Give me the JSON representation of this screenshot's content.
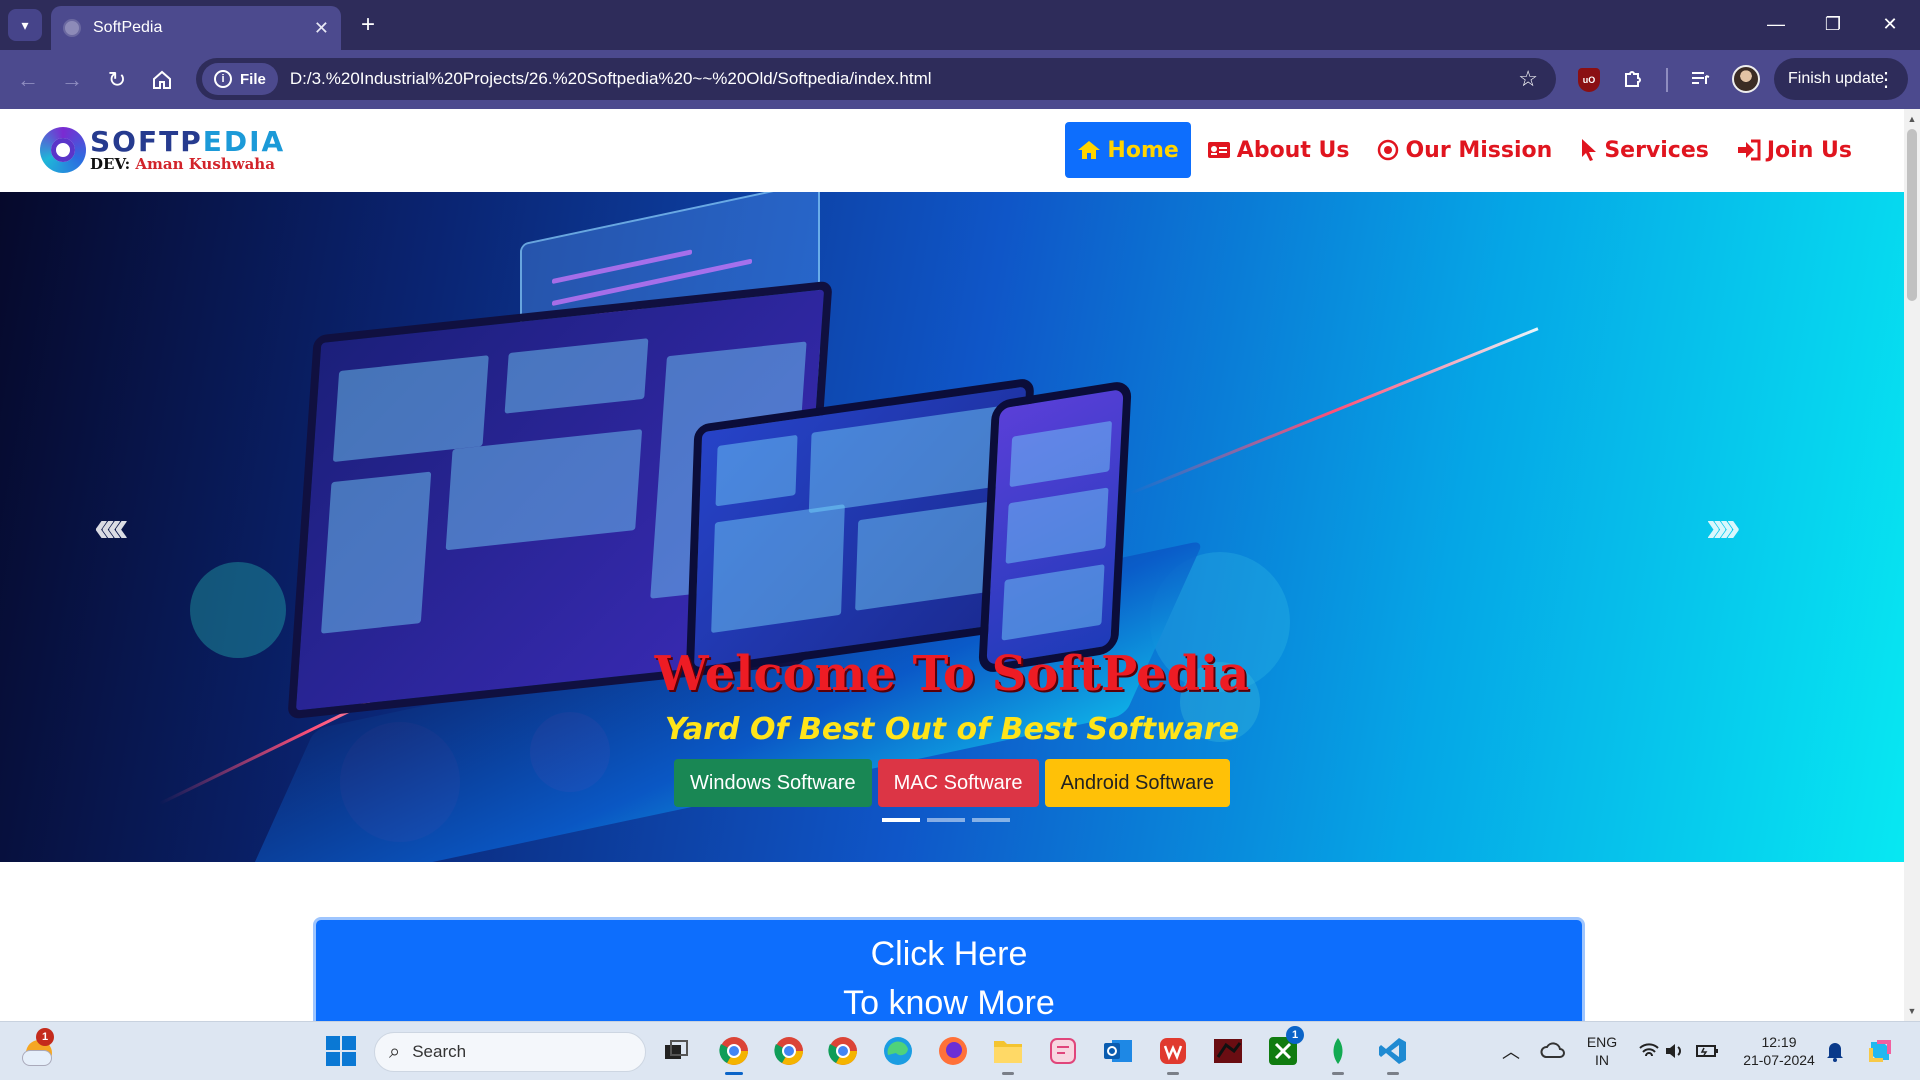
{
  "browser": {
    "tab_title": "SoftPedia",
    "url_chip": "File",
    "url": "D:/3.%20Industrial%20Projects/26.%20Softpedia%20~~%20Old/Softpedia/index.html",
    "finish_update": "Finish update",
    "ublock_label": "uO"
  },
  "site": {
    "logo_name_a": "SOFTP",
    "logo_name_b": "EDIA",
    "logo_dev_a": "DEV: ",
    "logo_dev_b": "Aman Kushwaha",
    "menu": [
      {
        "label": "Home",
        "icon": "home-icon"
      },
      {
        "label": "About Us",
        "icon": "id-card-icon"
      },
      {
        "label": "Our Mission",
        "icon": "target-icon"
      },
      {
        "label": "Services",
        "icon": "pointer-icon"
      },
      {
        "label": "Join Us",
        "icon": "sign-in-icon"
      }
    ],
    "hero": {
      "prev": "‹‹‹‹",
      "next": "››››",
      "title": "Welcome To SoftPedia",
      "subtitle": "Yard Of Best Out of Best Software",
      "buttons": [
        "Windows Software",
        "MAC Software",
        "Android Software"
      ],
      "active_slide": 1,
      "slide_count": 3
    },
    "more": {
      "line1": "Click Here",
      "line2": "To know More"
    }
  },
  "taskbar": {
    "search_placeholder": "Search",
    "weather_badge": "1",
    "xbox_badge": "1",
    "lang_line1": "ENG",
    "lang_line2": "IN",
    "time": "12:19",
    "date": "21-07-2024"
  },
  "colors": {
    "nav_accent": "#e0151f",
    "home_bg": "#0d6efd",
    "home_text": "#ffd400",
    "hero_title": "#ee1c24",
    "hero_subtitle": "#ffe41a",
    "browser_frame": "#4c4a8e"
  }
}
